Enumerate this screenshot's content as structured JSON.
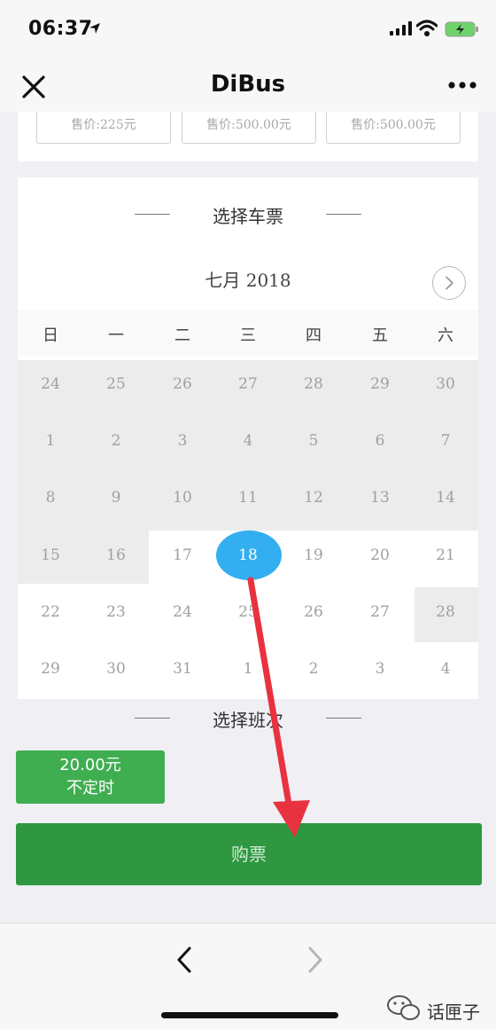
{
  "status_bar": {
    "time": "06:37"
  },
  "nav": {
    "title": "DiBus",
    "close_icon": "close-icon",
    "more_icon": "more-icon"
  },
  "prices": [
    {
      "label": "售价:225元"
    },
    {
      "label": "售价:500.00元"
    },
    {
      "label": "售价:500.00元"
    }
  ],
  "calendar": {
    "section_title": "选择车票",
    "month_label": "七月 2018",
    "weekdays": [
      "日",
      "一",
      "二",
      "三",
      "四",
      "五",
      "六"
    ],
    "weeks": [
      [
        "24",
        "25",
        "26",
        "27",
        "28",
        "29",
        "30"
      ],
      [
        "1",
        "2",
        "3",
        "4",
        "5",
        "6",
        "7"
      ],
      [
        "8",
        "9",
        "10",
        "11",
        "12",
        "13",
        "14"
      ],
      [
        "15",
        "16",
        "17",
        "18",
        "19",
        "20",
        "21"
      ],
      [
        "22",
        "23",
        "24",
        "25",
        "26",
        "27",
        "28"
      ],
      [
        "29",
        "30",
        "31",
        "1",
        "2",
        "3",
        "4"
      ]
    ],
    "selected_day": "18"
  },
  "shift": {
    "section_title": "选择班次",
    "option_price": "20.00元",
    "option_time": "不定时"
  },
  "buy_label": "购票",
  "watermark": {
    "label": "话匣子"
  },
  "colors": {
    "accent_green": "#3fae51",
    "buy_green": "#2e9740",
    "selected_blue": "#33aef0",
    "annotation_red": "#e8323f"
  }
}
